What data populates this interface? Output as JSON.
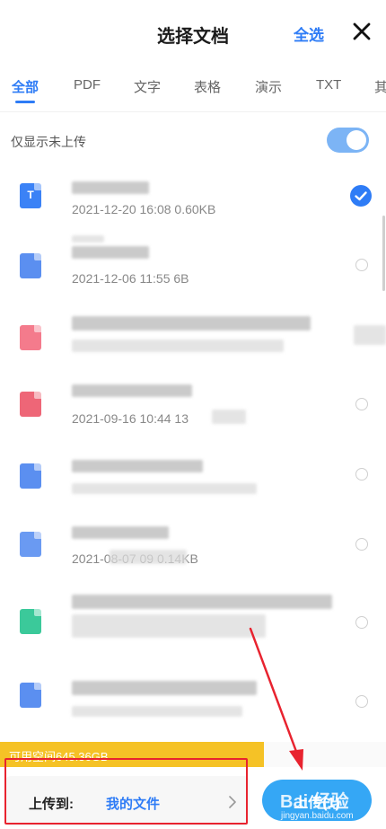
{
  "header": {
    "title": "选择文档",
    "select_all_label": "全选",
    "close_icon": "close-icon"
  },
  "tabs": [
    {
      "label": "全部",
      "active": true
    },
    {
      "label": "PDF"
    },
    {
      "label": "文字"
    },
    {
      "label": "表格"
    },
    {
      "label": "演示"
    },
    {
      "label": "TXT"
    },
    {
      "label": "其"
    }
  ],
  "filter": {
    "label": "仅显示未上传",
    "toggle_on": true
  },
  "files": [
    {
      "icon_color": "#3b82f6",
      "icon_letter": "T",
      "meta": "2021-12-20  16:08  0.60KB",
      "selected": true
    },
    {
      "icon_color": "#5b8ff0",
      "meta": "2021-12-06  11:55  6B",
      "selected": false
    },
    {
      "icon_color": "#f47b8c",
      "meta": "",
      "selected": false
    },
    {
      "icon_color": "#ee6677",
      "meta": "2021-09-16  10:44  13",
      "selected": false
    },
    {
      "icon_color": "#5b8ff0",
      "meta": "",
      "selected": false
    },
    {
      "icon_color": "#6a9af2",
      "meta": "2021-08-07      09  0.14KB",
      "selected": false
    },
    {
      "icon_color": "#3bc99a",
      "meta": "",
      "selected": false
    },
    {
      "icon_color": "#5b8ff0",
      "meta": "",
      "selected": false
    }
  ],
  "storage": {
    "text": "可用空间645.36GB"
  },
  "bottom": {
    "dest_label": "上传到:",
    "dest_value": "我的文件",
    "upload_label": "上传(1)"
  },
  "watermark": {
    "line1": "Bai 经验",
    "line2": "jingyan.baidu.com"
  },
  "colors": {
    "accent": "#2e7cf6",
    "storage": "#f5c226",
    "annotation": "#e8232f"
  }
}
